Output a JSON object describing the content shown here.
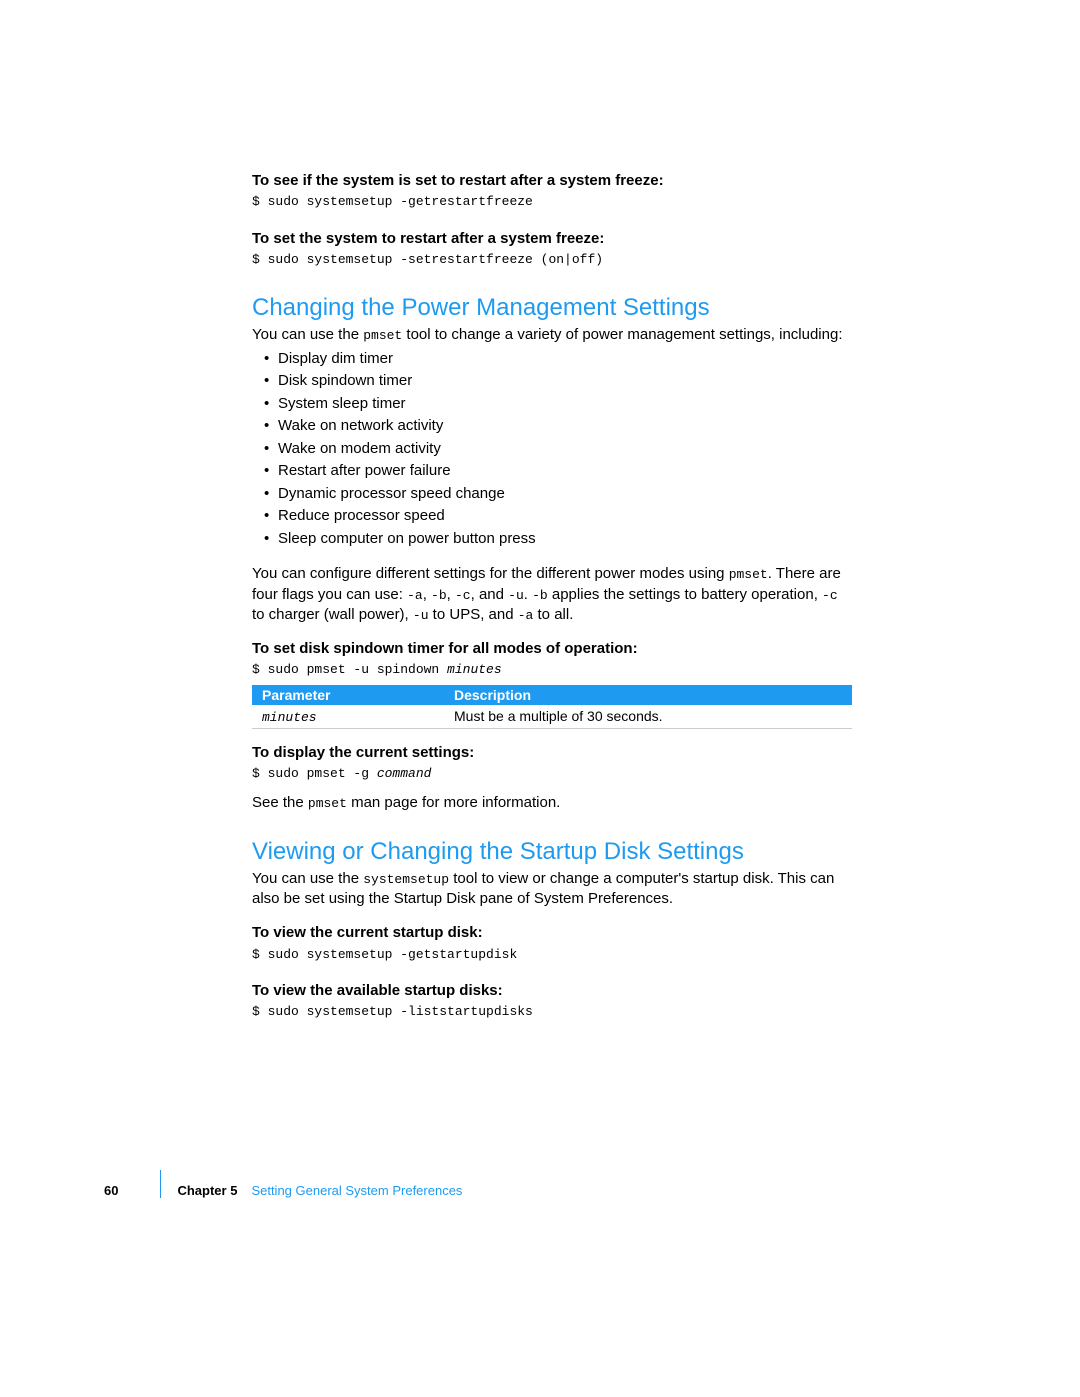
{
  "sec1": {
    "h1": "To see if the system is set to restart after a system freeze:",
    "c1": "$ sudo systemsetup -getrestartfreeze",
    "h2": "To set the system to restart after a system freeze:",
    "c2": "$ sudo systemsetup -setrestartfreeze (on|off)"
  },
  "pm": {
    "title": "Changing the Power Management Settings",
    "p1a": "You can use the ",
    "p1code": "pmset",
    "p1b": " tool to change a variety of power management settings, including:",
    "bullets": [
      "Display dim timer",
      "Disk spindown timer",
      "System sleep timer",
      "Wake on network activity",
      "Wake on modem activity",
      "Restart after power failure",
      "Dynamic processor speed change",
      "Reduce processor speed",
      "Sleep computer on power button press"
    ],
    "p2a": "You can configure different settings for the different power modes using ",
    "p2code1": "pmset",
    "p2b": ". There are four flags you can use:  ",
    "p2code2": "-a",
    "p2c": ", ",
    "p2code3": "-b",
    "p2d": ", ",
    "p2code4": "-c",
    "p2e": ", and ",
    "p2code5": "-u",
    "p2f": ". ",
    "p2code6": "-b",
    "p2g": " applies the settings to battery operation, ",
    "p2code7": "-c",
    "p2h": " to charger (wall power), ",
    "p2code8": "-u",
    "p2i": " to UPS, and ",
    "p2code9": "-a",
    "p2j": " to all.",
    "h3": "To set disk spindown timer for all modes of operation:",
    "c3a": "$ sudo pmset -u spindown ",
    "c3b": "minutes",
    "table": {
      "th1": "Parameter",
      "th2": "Description",
      "td1": "minutes",
      "td2": "Must be a multiple of 30 seconds."
    },
    "h4": "To display the current settings:",
    "c4a": "$ sudo pmset -g ",
    "c4b": "command",
    "p3a": "See the ",
    "p3code": "pmset",
    "p3b": " man page for more information."
  },
  "sd": {
    "title": "Viewing or Changing the Startup Disk Settings",
    "p1a": "You can use the ",
    "p1code": "systemsetup",
    "p1b": " tool to view or change a computer's startup disk. This can also be set using the Startup Disk pane of System Preferences.",
    "h1": "To view the current startup disk:",
    "c1": "$ sudo systemsetup -getstartupdisk",
    "h2": "To view the available startup disks:",
    "c2": "$ sudo systemsetup -liststartupdisks"
  },
  "footer": {
    "page": "60",
    "chapter": "Chapter 5",
    "title": "Setting General System Preferences"
  }
}
